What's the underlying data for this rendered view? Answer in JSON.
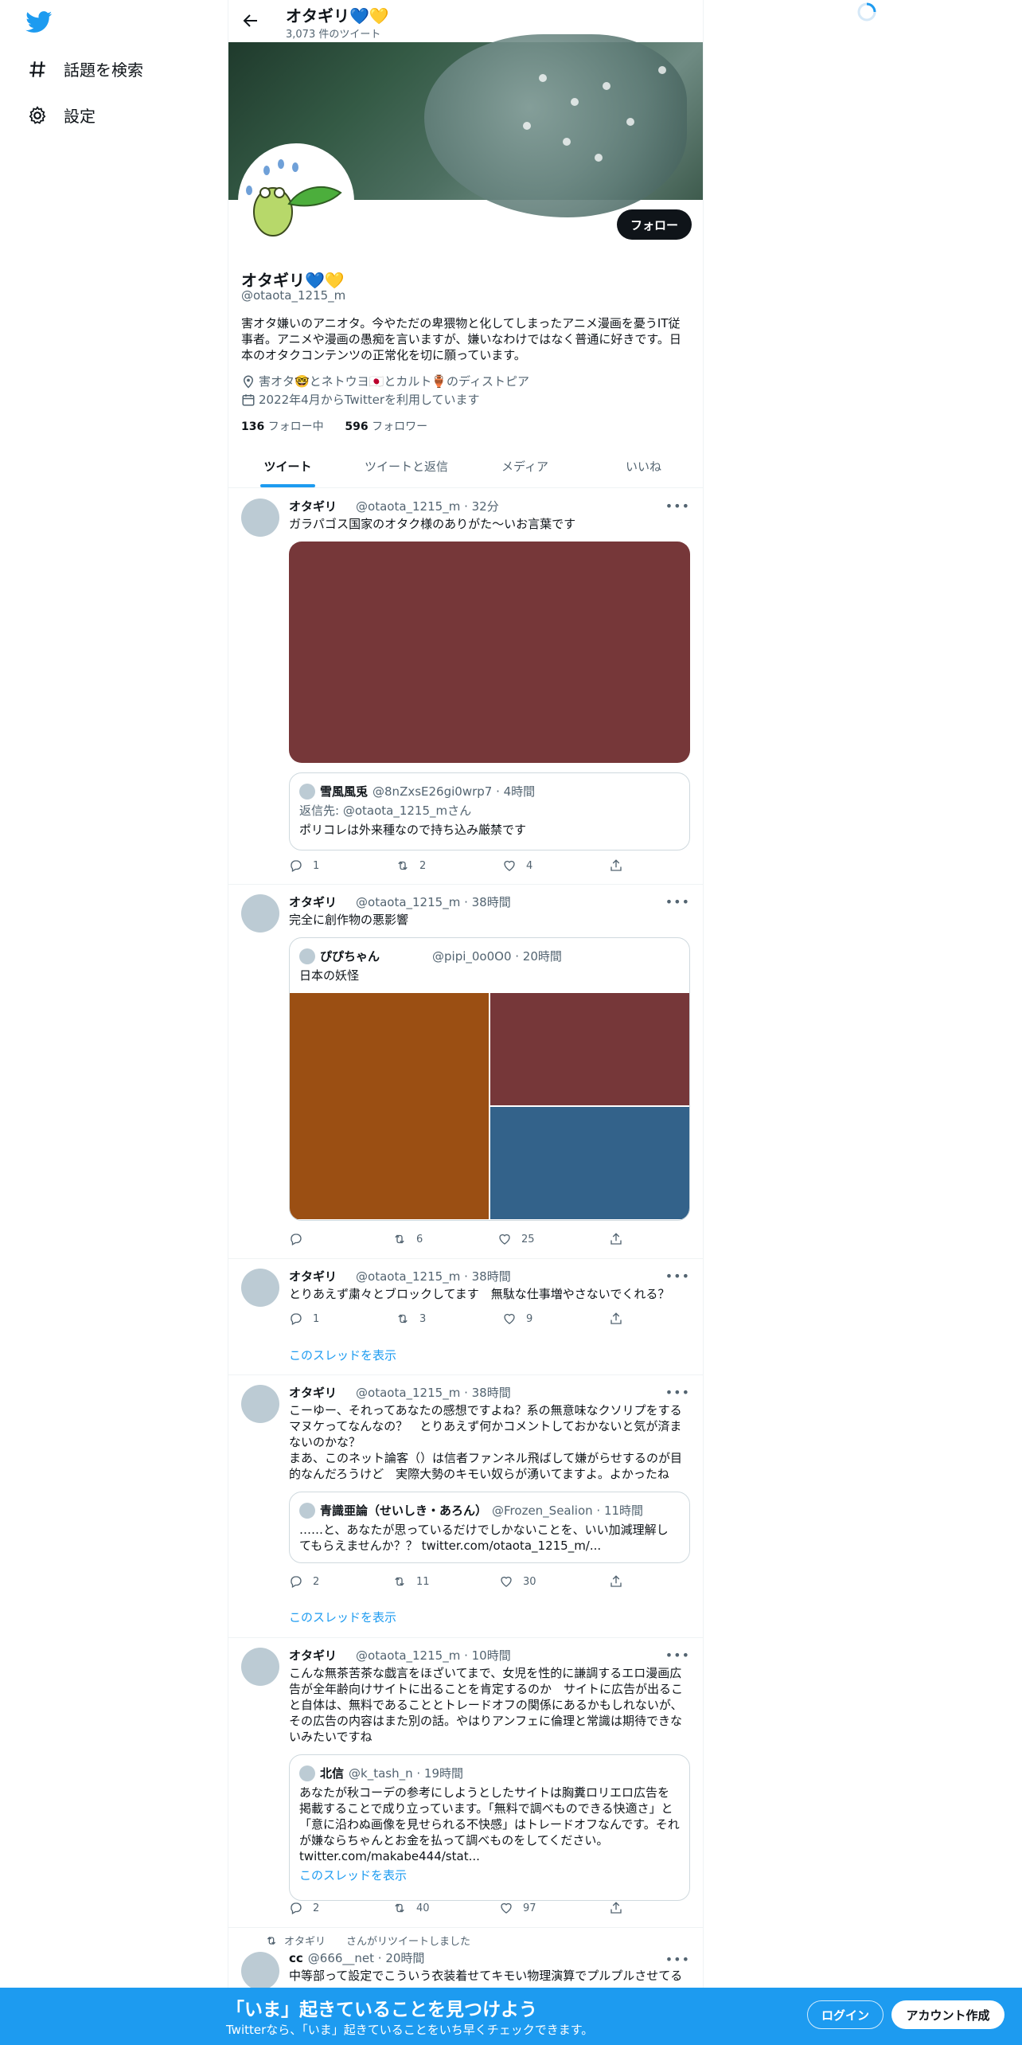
{
  "colors": {
    "accent": "#1d9bf0",
    "avatar_placeholder": "#bccbd4",
    "follow_button": "#0f1419"
  },
  "sidebar": {
    "items": [
      {
        "label": "話題を検索",
        "icon": "hash-icon"
      },
      {
        "label": "設定",
        "icon": "gear-icon"
      }
    ]
  },
  "header": {
    "name": "オタギリ💙💛",
    "tweet_count": "3,073 件のツイート"
  },
  "profile": {
    "name": "オタギリ💙💛",
    "handle": "@otaota_1215_m",
    "bio": "害オタ嫌いのアニオタ。今やただの卑猥物と化してしまったアニメ漫画を憂うIT従事者。アニメや漫画の愚痴を言いますが、嫌いなわけではなく普通に好きです。日本のオタクコンテンツの正常化を切に願っています。",
    "location": "害オタ🤓とネトウヨ🇯🇵とカルト🏺のディストピア",
    "joined": "2022年4月からTwitterを利用しています",
    "following_count": "136",
    "following_label": "フォロー中",
    "followers_count": "596",
    "followers_label": "フォロワー",
    "follow_button": "フォロー"
  },
  "tabs": [
    "ツイート",
    "ツイートと返信",
    "メディア",
    "いいね"
  ],
  "tweets": [
    {
      "name": "オタギリ",
      "sub": "@otaota_1215_m · 32分",
      "text": "ガラパゴス国家のオタク様のありがた〜いお言葉です",
      "media_color": "#763739",
      "quote": {
        "name": "雪風風兎",
        "sub": "@8nZxsE26gi0wrp7 · 4時間",
        "reply": "返信先: @otaota_1215_mさん",
        "text": "ポリコレは外来種なので持ち込み厳禁です"
      },
      "replies": "1",
      "retweets": "2",
      "likes": "4"
    },
    {
      "name": "オタギリ",
      "sub": "@otaota_1215_m · 38時間",
      "text": "完全に創作物の悪影響",
      "quote": {
        "name": "ぴぴちゃん",
        "sub": "@pipi_0o0O0 · 20時間",
        "text": "日本の妖怪",
        "colors": [
          "#9b4f13",
          "#763739",
          "#33628a"
        ]
      },
      "replies": "",
      "retweets": "6",
      "likes": "25"
    },
    {
      "name": "オタギリ",
      "sub": "@otaota_1215_m · 38時間",
      "text": "とりあえず粛々とブロックしてます　無駄な仕事増やさないでくれる？",
      "replies": "1",
      "retweets": "3",
      "likes": "9",
      "thread": "このスレッドを表示"
    },
    {
      "name": "オタギリ",
      "sub": "@otaota_1215_m · 38時間",
      "text": "こーゆー、それってあなたの感想ですよね？系の無意味なクソリプをするマヌケってなんなの？　とりあえず何かコメントしておかないと気が済まないのかな？\nまあ、このネット論客（）は信者ファンネル飛ばして嫌がらせするのが目的なんだろうけど　実際大勢のキモい奴らが湧いてますよ。よかったね",
      "quote": {
        "name": "青識亜論（せいしき・あろん）",
        "sub": "@Frozen_Sealion · 11時間",
        "text": "……と、あなたが思っているだけでしかないことを、いい加減理解してもらえませんか？？ twitter.com/otaota_1215_m/..."
      },
      "replies": "2",
      "retweets": "11",
      "likes": "30",
      "thread": "このスレッドを表示"
    },
    {
      "name": "オタギリ",
      "sub": "@otaota_1215_m · 10時間",
      "text": "こんな無茶苦茶な戯言をほざいてまで、女児を性的に謙調するエロ漫画広告が全年齢向けサイトに出ることを肯定するのか　サイトに広告が出ること自体は、無料であることとトレードオフの関係にあるかもしれないが、その広告の内容はまた別の話。やはりアンフェに倫理と常識は期待できないみたいですね",
      "quote": {
        "name": "北信",
        "sub": "@k_tash_n · 19時間",
        "text": "あなたが秋コーデの参考にしようとしたサイトは胸糞ロリエロ広告を掲載することで成り立っています。「無料で調べものできる快適さ」と「意に沿わぬ画像を見せられる不快感」はトレードオフなんです。それが嫌ならちゃんとお金を払って調べものをしてください。\ntwitter.com/makabe444/stat...",
        "thread": "このスレッドを表示"
      },
      "replies": "2",
      "retweets": "40",
      "likes": "97"
    },
    {
      "retweeted_by": "オタギリ　　さんがリツイートしました",
      "name": "cc",
      "sub": "@666__net · 20時間",
      "text": "中等部って設定でこういう衣装着せてキモい物理演算でプルプルさせてる"
    }
  ],
  "bottom_bar": {
    "title": "「いま」起きていることを見つけよう",
    "subtitle": "Twitterなら、「いま」起きていることをいち早くチェックできます。",
    "login": "ログイン",
    "signup": "アカウント作成"
  }
}
